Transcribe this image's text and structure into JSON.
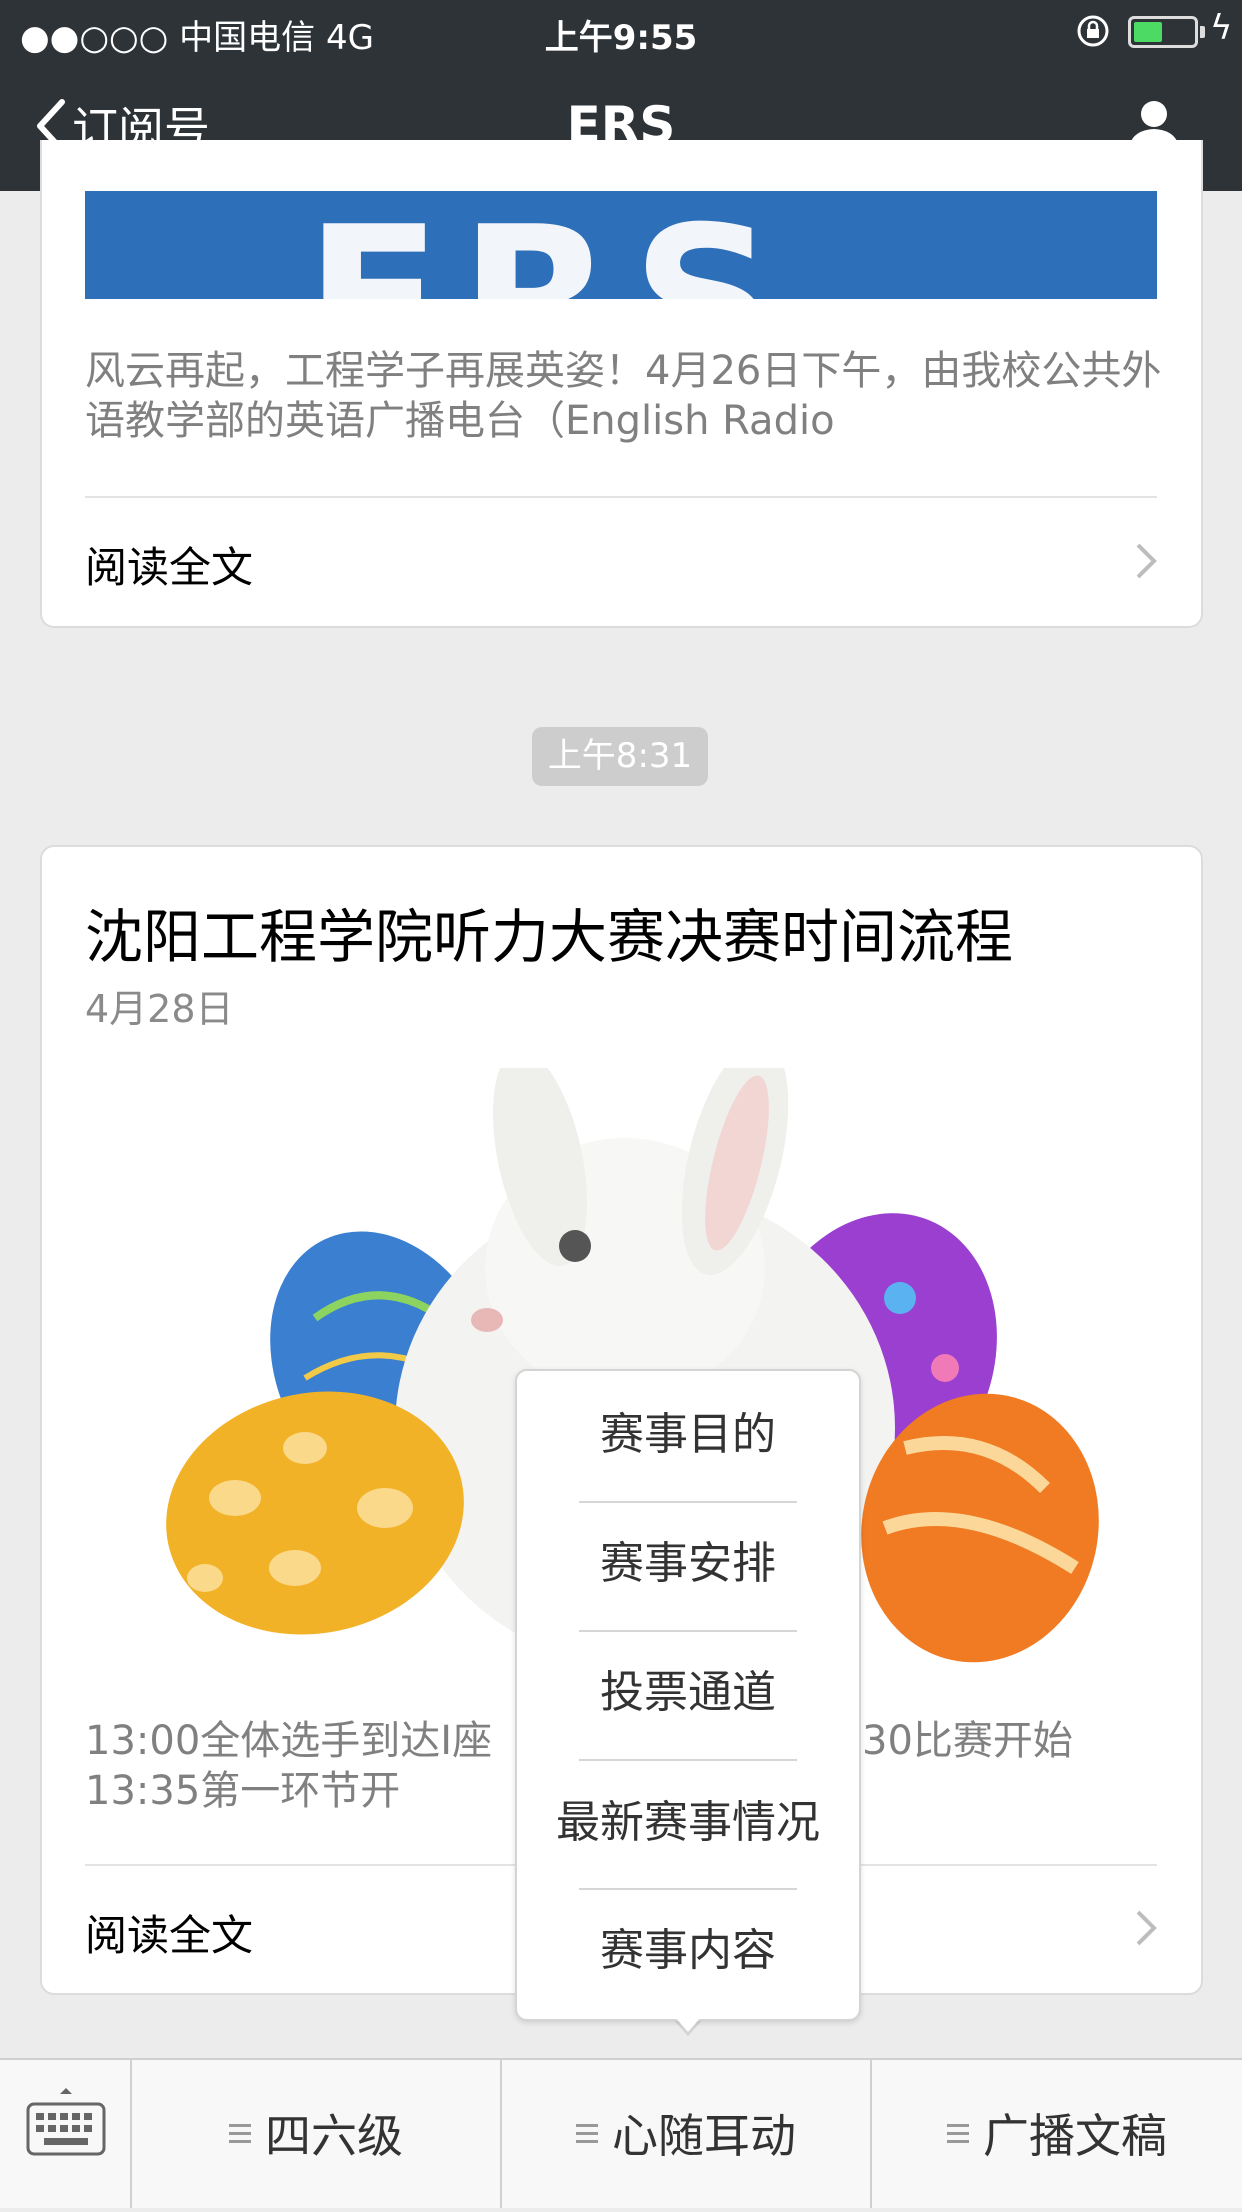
{
  "status_bar": {
    "carrier": "●●○○○ 中国电信   4G",
    "time": "上午9:55",
    "charging": "ϟ"
  },
  "nav": {
    "back_label": "订阅号",
    "title": "ERS"
  },
  "banner": {
    "text": "ERS"
  },
  "card1": {
    "description": "风云再起，工程学子再展英姿！4月26日下午，由我校公共外语教学部的英语广播电台（English Radio",
    "read_more": "阅读全文"
  },
  "timestamp": "上午8:31",
  "card2": {
    "title": "沈阳工程学院听力大赛决赛时间流程",
    "date": "4月28日",
    "description_left": "13:00全体选手到达I座",
    "description_right": "30比赛开始",
    "description_line2": "13:35第一环节开",
    "read_more": "阅读全文"
  },
  "popup_menu": {
    "items": [
      "赛事目的",
      "赛事安排",
      "投票通道",
      "最新赛事情况",
      "赛事内容"
    ]
  },
  "bottom_menu": {
    "items": [
      "四六级",
      "心随耳动",
      "广播文稿"
    ]
  },
  "colors": {
    "nav_bg": "#2e3338",
    "banner_blue": "#2e6fba",
    "battery_green": "#4cd964"
  }
}
